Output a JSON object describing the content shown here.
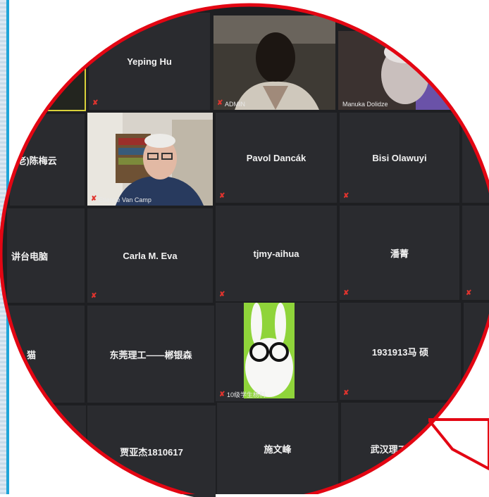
{
  "tiles": {
    "t_yeping": {
      "name": "Yeping Hu"
    },
    "t_admin": {
      "label": "ADMIN"
    },
    "t_manuka": {
      "label": "Manuka Dolidze"
    },
    "t_chen": {
      "name": "(老)陈梅云"
    },
    "t_etienne": {
      "label": "Etienne Van Camp"
    },
    "t_pavol": {
      "name": "Pavol Dancák"
    },
    "t_bisi": {
      "name": "Bisi Olawuyi"
    },
    "t_jiang": {
      "name": "讲台电脑"
    },
    "t_carla": {
      "name": "Carla M. Eva"
    },
    "t_tjmy": {
      "name": "tjmy-aihua"
    },
    "t_pan": {
      "name": "潘菁"
    },
    "t_left4": {
      "name": "猫"
    },
    "t_dongguan": {
      "name": "东莞理工——郴银森"
    },
    "t_bunny": {
      "label": "10级学生杨科"
    },
    "t_ma": {
      "name": "1931913马 硕"
    },
    "t_jia": {
      "name": "贾亚杰1810617"
    },
    "t_shi": {
      "name": "施文峰"
    },
    "t_wuhan": {
      "name": "武汉理工大学..."
    }
  },
  "colors": {
    "outline": "#e30613",
    "tile_bg": "#2a2b2f",
    "grid_bg": "#1e1f22",
    "muted_mic": "#e0342e",
    "frame_accent": "#1fa4d8"
  }
}
